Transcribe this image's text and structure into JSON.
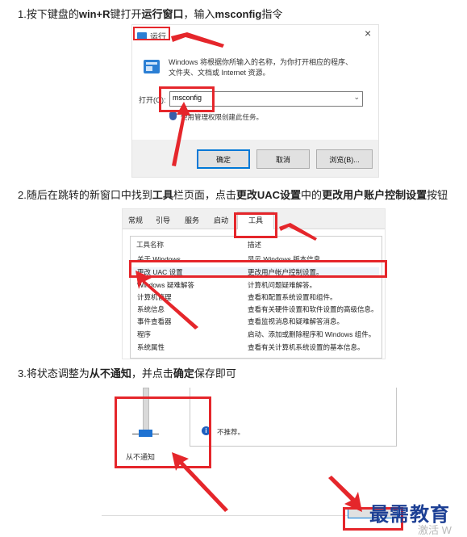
{
  "step1": {
    "prefix": "1.按下键盘的",
    "b1": "win+R",
    "mid": "键打开",
    "b2": "运行窗口",
    "mid2": "，输入",
    "b3": "msconfig",
    "suffix": "指令"
  },
  "run_dialog": {
    "title": "运行",
    "close": "×",
    "desc_line1": "Windows 将根据你所输入的名称，为你打开相应的程序、",
    "desc_line2": "文件夹、文档或 Internet 资源。",
    "open_label": "打开(O):",
    "input_value": "msconfig",
    "admin_note": "使用管理权限创建此任务。",
    "ok": "确定",
    "cancel": "取消",
    "browse": "浏览(B)..."
  },
  "step2": {
    "prefix": "2.随后在跳转的新窗口中找到",
    "b1": "工具",
    "mid": "栏页面，点击",
    "b2": "更改UAC设置",
    "mid2": "中的",
    "b3": "更改用户账户控制设置",
    "suffix": "按钮"
  },
  "msconfig": {
    "tabs": [
      "常规",
      "引导",
      "服务",
      "启动",
      "工具"
    ],
    "col_name": "工具名称",
    "col_desc": "描述",
    "tools": [
      {
        "name": "关于 Windows",
        "desc": "显示 Windows 版本信息。"
      },
      {
        "name": "更改 UAC 设置",
        "desc": "更改用户帐户控制设置。"
      },
      {
        "name": "Windows 疑难解答",
        "desc": "计算机问题疑难解答。"
      },
      {
        "name": "计算机管理",
        "desc": "查看和配置系统设置和组件。"
      },
      {
        "name": "系统信息",
        "desc": "查看有关硬件设置和软件设置的高级信息。"
      },
      {
        "name": "事件查看器",
        "desc": "查看监视消息和疑难解答消息。"
      },
      {
        "name": "程序",
        "desc": "启动、添加或删除程序和 Windows 组件。"
      },
      {
        "name": "系统属性",
        "desc": "查看有关计算机系统设置的基本信息。"
      }
    ]
  },
  "step3": {
    "prefix": "3.将状态调整为",
    "b1": "从不通知",
    "mid": "，并点击",
    "b2": "确定",
    "suffix": "保存即可"
  },
  "uac": {
    "slider_label": "从不通知",
    "info_text": "不推荐。",
    "info_icon": "i"
  },
  "watermark": {
    "main": "最需教育",
    "faint": "激活 W"
  },
  "colors": {
    "red": "#e5262b",
    "blue_accent": "#0078d7",
    "watermark_blue": "#1c3f94"
  }
}
